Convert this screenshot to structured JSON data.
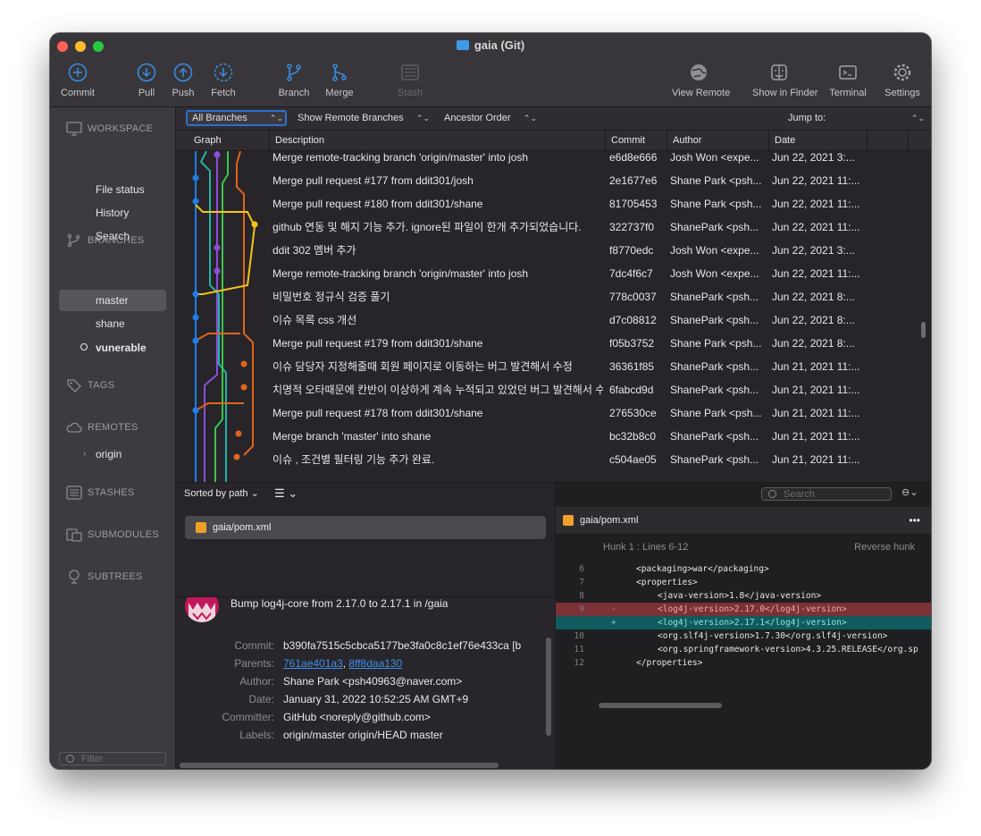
{
  "window": {
    "title": "gaia (Git)"
  },
  "toolbar": {
    "commit": "Commit",
    "pull": "Pull",
    "push": "Push",
    "fetch": "Fetch",
    "branch": "Branch",
    "merge": "Merge",
    "stash": "Stash",
    "view_remote": "View Remote",
    "show_in_finder": "Show in Finder",
    "terminal": "Terminal",
    "settings": "Settings"
  },
  "sidebar": {
    "workspace": "WORKSPACE",
    "file_status": "File status",
    "history": "History",
    "search": "Search",
    "branches": "BRANCHES",
    "branch_items": [
      "master",
      "shane",
      "vunerable"
    ],
    "tags": "TAGS",
    "remotes": "REMOTES",
    "origin": "origin",
    "stashes": "STASHES",
    "submodules": "SUBMODULES",
    "subtrees": "SUBTREES",
    "filter_placeholder": "Filter"
  },
  "filterbar": {
    "all_branches": "All Branches",
    "show_remote": "Show Remote Branches",
    "order": "Ancestor Order",
    "jump_to": "Jump to:"
  },
  "columns": {
    "graph": "Graph",
    "description": "Description",
    "commit": "Commit",
    "author": "Author",
    "date": "Date"
  },
  "commits": [
    {
      "desc": "Merge remote-tracking branch 'origin/master' into josh",
      "hash": "e6d8e666",
      "author": "Josh Won <expe...",
      "date": "Jun 22, 2021 3:..."
    },
    {
      "desc": "Merge pull request #177 from ddit301/josh",
      "hash": "2e1677e6",
      "author": "Shane Park <psh...",
      "date": "Jun 22, 2021 11:..."
    },
    {
      "desc": "Merge pull request #180 from ddit301/shane",
      "hash": "81705453",
      "author": "Shane Park <psh...",
      "date": "Jun 22, 2021 11:..."
    },
    {
      "desc": "github 연동 및 해지 기능 추가. ignore된 파일이 한개 추가되었습니다.",
      "hash": "322737f0",
      "author": "ShanePark <psh...",
      "date": "Jun 22, 2021 11:..."
    },
    {
      "desc": "ddit 302 멤버 추가",
      "hash": "f8770edc",
      "author": "Josh Won <expe...",
      "date": "Jun 22, 2021 3:..."
    },
    {
      "desc": "Merge remote-tracking branch 'origin/master' into josh",
      "hash": "7dc4f6c7",
      "author": "Josh Won <expe...",
      "date": "Jun 22, 2021 11:..."
    },
    {
      "desc": "비밀번호 정규식 검증 풀기",
      "hash": "778c0037",
      "author": "ShanePark <psh...",
      "date": "Jun 22, 2021 8:..."
    },
    {
      "desc": "이슈 목록 css 개선",
      "hash": "d7c08812",
      "author": "ShanePark <psh...",
      "date": "Jun 22, 2021 8:..."
    },
    {
      "desc": "Merge pull request #179 from ddit301/shane",
      "hash": "f05b3752",
      "author": "Shane Park <psh...",
      "date": "Jun 22, 2021 8:..."
    },
    {
      "desc": "이슈 담당자 지정해줄때 회원 페이지로 이동하는 버그 발견해서 수정",
      "hash": "36361f85",
      "author": "ShanePark <psh...",
      "date": "Jun 21, 2021 11:..."
    },
    {
      "desc": "치명적 오타때문에 칸반이 이상하게 계속 누적되고 있었던 버그 발견해서 수정",
      "hash": "6fabcd9d",
      "author": "ShanePark <psh...",
      "date": "Jun 21, 2021 11:..."
    },
    {
      "desc": "Merge pull request #178 from ddit301/shane",
      "hash": "276530ce",
      "author": "Shane Park <psh...",
      "date": "Jun 21, 2021 11:..."
    },
    {
      "desc": "Merge branch 'master' into shane",
      "hash": "bc32b8c0",
      "author": "ShanePark <psh...",
      "date": "Jun 21, 2021 11:..."
    },
    {
      "desc": "이슈 , 조건별 필터링 기능 추가 완료.",
      "hash": "c504ae05",
      "author": "ShanePark <psh...",
      "date": "Jun 21, 2021 11:..."
    }
  ],
  "files_pane": {
    "sort_label": "Sorted by path",
    "file": "gaia/pom.xml"
  },
  "commit_detail": {
    "message": "Bump log4j-core from 2.17.0 to 2.17.1 in /gaia",
    "commit_label": "Commit:",
    "commit_value": "b390fa7515c5cbca5177be3fa0c8c1ef76e433ca [b",
    "parents_label": "Parents:",
    "parent1": "761ae401a3",
    "parent_sep": ", ",
    "parent2": "8ff8daa130",
    "author_label": "Author:",
    "author_value": "Shane Park <psh40963@naver.com>",
    "date_label": "Date:",
    "date_value": "January 31, 2022 10:52:25 AM GMT+9",
    "committer_label": "Committer:",
    "committer_value": "GitHub <noreply@github.com>",
    "labels_label": "Labels:",
    "labels_value": "origin/master origin/HEAD master"
  },
  "diff": {
    "search_placeholder": "Search",
    "file": "gaia/pom.xml",
    "more": "•••",
    "hunk_label": "Hunk 1 : Lines 6-12",
    "reverse": "Reverse hunk",
    "lines": [
      {
        "n": "6",
        "mark": "",
        "text": "<packaging>war</packaging>",
        "indent": 0,
        "type": "ctx"
      },
      {
        "n": "7",
        "mark": "",
        "text": "<properties>",
        "indent": 0,
        "type": "ctx"
      },
      {
        "n": "8",
        "mark": "",
        "text": "<java-version>1.8</java-version>",
        "indent": 1,
        "type": "ctx"
      },
      {
        "n": "9",
        "mark": "-",
        "text": "<log4j-version>2.17.0</log4j-version>",
        "indent": 1,
        "type": "del"
      },
      {
        "n": "",
        "mark": "+",
        "text": "<log4j-version>2.17.1</log4j-version>",
        "indent": 1,
        "type": "add"
      },
      {
        "n": "10",
        "mark": "",
        "text": "<org.slf4j-version>1.7.30</org.slf4j-version>",
        "indent": 1,
        "type": "ctx"
      },
      {
        "n": "11",
        "mark": "",
        "text": "<org.springframework-version>4.3.25.RELEASE</org.sp",
        "indent": 1,
        "type": "ctx"
      },
      {
        "n": "12",
        "mark": "",
        "text": "</properties>",
        "indent": 0,
        "type": "ctx"
      }
    ]
  },
  "colors": {
    "accent": "#2f6fd0",
    "graph_blue": "#1f7ee8",
    "graph_purple": "#8a4fd8",
    "graph_teal": "#1fb3a4",
    "graph_green": "#3cc44c",
    "graph_orange": "#e0651c",
    "graph_yellow": "#f5c518",
    "diff_del": "#7b3136",
    "diff_add": "#0f5b5d"
  }
}
